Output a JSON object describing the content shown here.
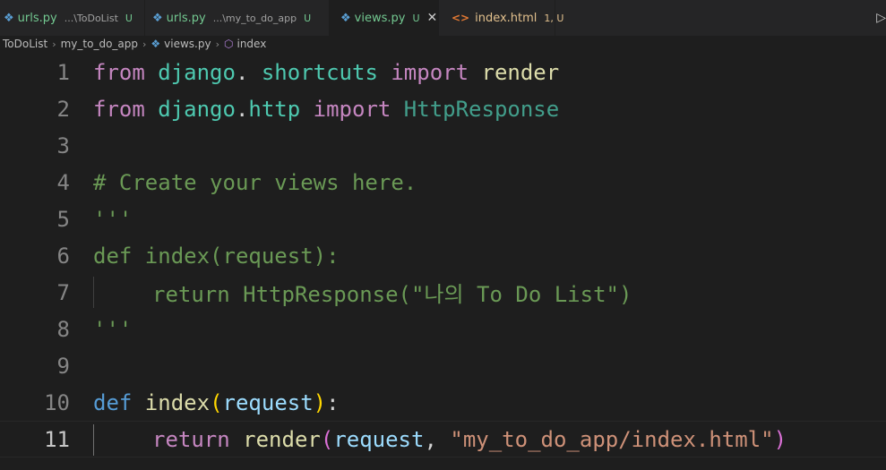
{
  "tabs": [
    {
      "name": "urls.py",
      "desc": "...\\ToDoList",
      "badge": "U"
    },
    {
      "name": "urls.py",
      "desc": "...\\my_to_do_app",
      "badge": "U"
    },
    {
      "name": "views.py",
      "badge": "U",
      "close": "✕"
    },
    {
      "name": "index.html",
      "badge": "1, U"
    }
  ],
  "breadcrumb": [
    "ToDoList",
    "my_to_do_app",
    "views.py",
    "index"
  ],
  "line_numbers": [
    "1",
    "2",
    "3",
    "4",
    "5",
    "6",
    "7",
    "8",
    "9",
    "10",
    "11"
  ],
  "code": {
    "l1": [
      "from",
      " django",
      ".",
      " shortcuts",
      " import",
      " render"
    ],
    "l2": [
      "from",
      " django",
      ".",
      "http",
      " import",
      " HttpResponse"
    ],
    "l4": "# Create your views here.",
    "l5": "'''",
    "l6": "def index(request):",
    "l7": "return HttpResponse(\"나의 To Do List\")",
    "l8": "'''",
    "l10": [
      "def",
      " index",
      "(",
      "request",
      ")",
      ":"
    ],
    "l11": [
      "return",
      " render",
      "(",
      "request",
      ", ",
      "\"my_to_do_app/index.html\"",
      ")"
    ]
  },
  "colors": {
    "background": "#1e1e1e",
    "keyword": "#c586c0",
    "module": "#4ec9b0",
    "comment": "#6a9955",
    "string": "#ce9178"
  }
}
